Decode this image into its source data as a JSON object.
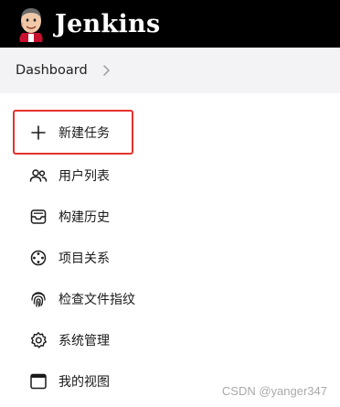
{
  "header": {
    "brand": "Jenkins",
    "logo_icon": "jenkins-butler-logo"
  },
  "breadcrumb": {
    "items": [
      "Dashboard"
    ],
    "separator_icon": "chevron-right-icon"
  },
  "menu": {
    "items": [
      {
        "label": "新建任务",
        "icon": "plus-icon",
        "highlighted": true
      },
      {
        "label": "用户列表",
        "icon": "people-icon"
      },
      {
        "label": "构建历史",
        "icon": "inbox-icon"
      },
      {
        "label": "项目关系",
        "icon": "relationship-icon"
      },
      {
        "label": "检查文件指纹",
        "icon": "fingerprint-icon"
      },
      {
        "label": "系统管理",
        "icon": "gear-icon"
      },
      {
        "label": "我的视图",
        "icon": "window-icon"
      }
    ]
  },
  "watermark": "CSDN @yanger347",
  "colors": {
    "header_bg": "#000000",
    "breadcrumb_bg": "#f3f3f5",
    "highlight_border": "#e5322d"
  }
}
